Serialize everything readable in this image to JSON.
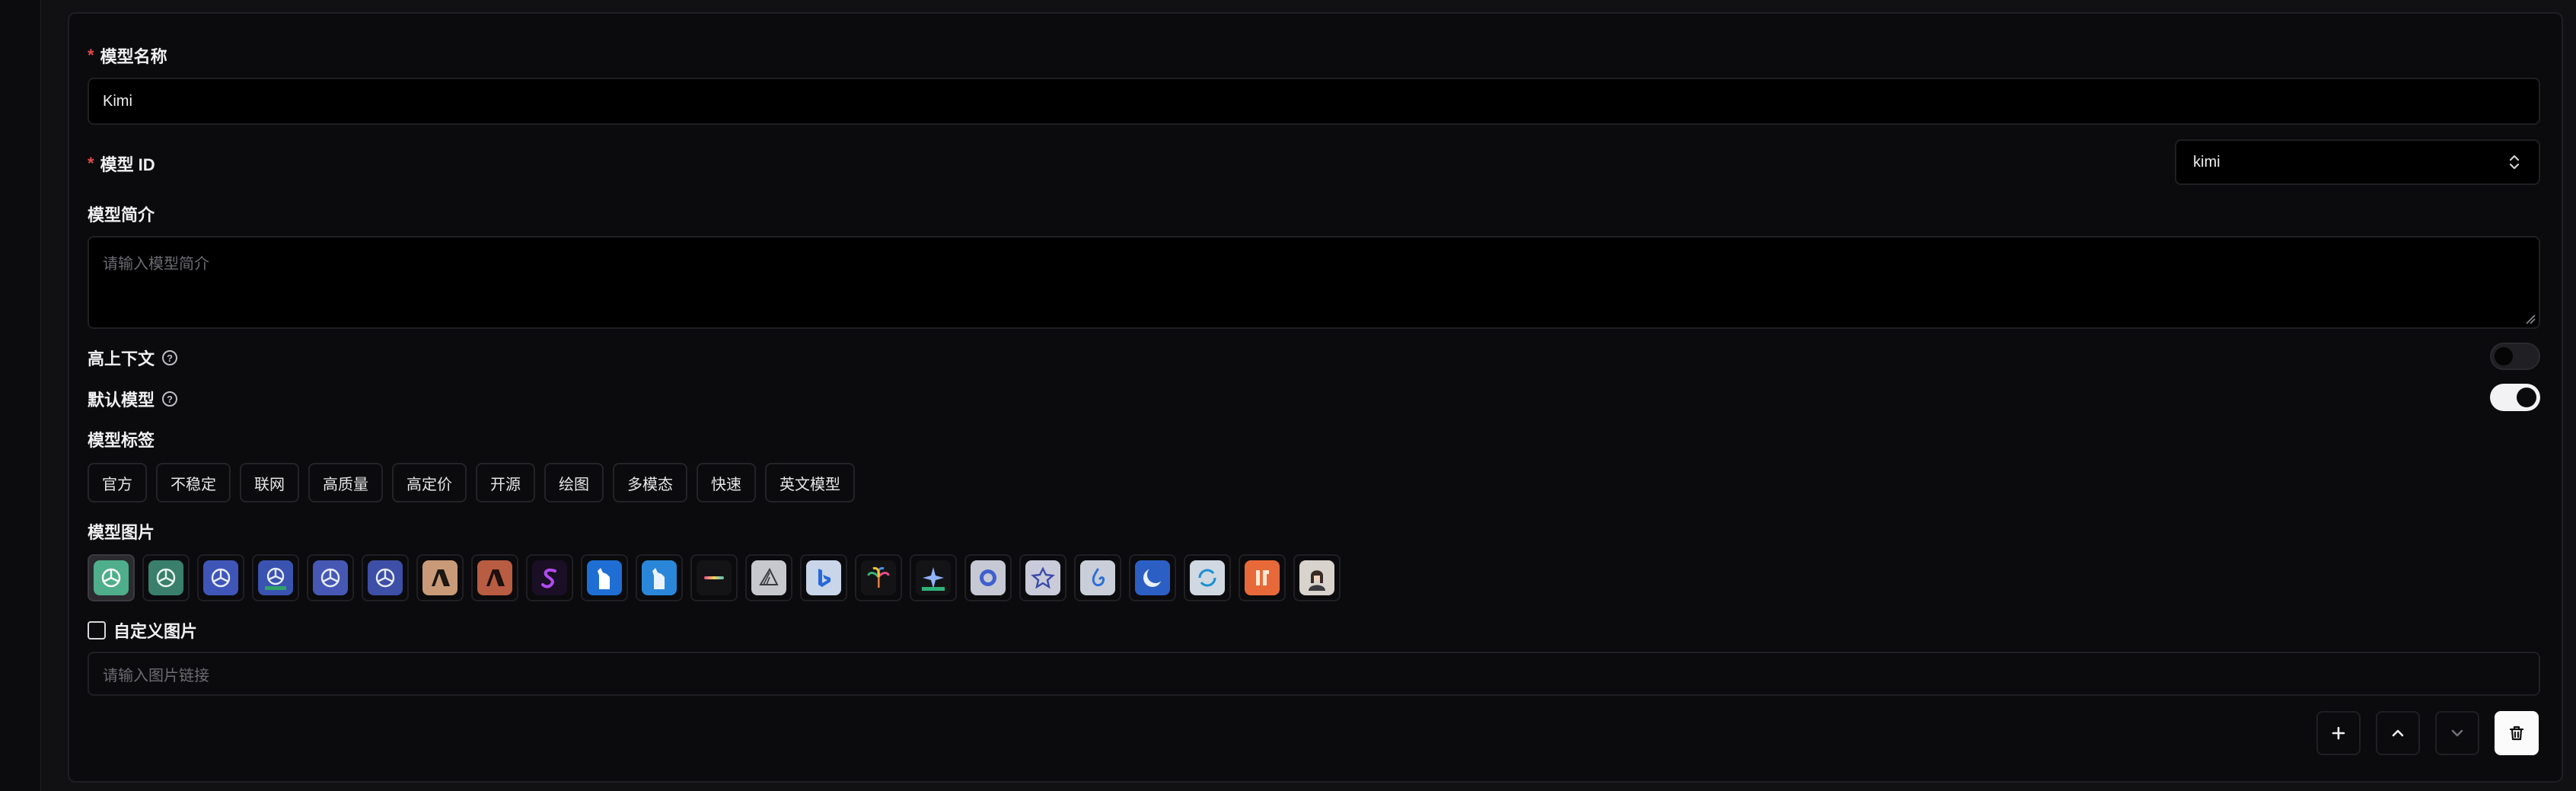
{
  "form": {
    "model_name": {
      "label": "模型名称",
      "required_mark": "*",
      "value": "Kimi"
    },
    "model_id": {
      "label": "模型 ID",
      "required_mark": "*",
      "selected": "kimi"
    },
    "model_desc": {
      "label": "模型简介",
      "placeholder": "请输入模型简介"
    },
    "long_context": {
      "label": "高上下文",
      "help_icon": "?",
      "enabled": false
    },
    "default_model": {
      "label": "默认模型",
      "help_icon": "?",
      "enabled": true
    },
    "model_tags": {
      "label": "模型标签",
      "items": [
        "官方",
        "不稳定",
        "联网",
        "高质量",
        "高定价",
        "开源",
        "绘图",
        "多模态",
        "快速",
        "英文模型"
      ]
    },
    "model_image": {
      "label": "模型图片",
      "selected_index": 0,
      "icons": [
        "openai-green-icon",
        "openai-teal-icon",
        "openai-blue-icon",
        "openai-blue-4-icon",
        "openai-blue-icon",
        "openai-blue-icon",
        "anthropic-tan-icon",
        "anthropic-rust-icon",
        "stable-s-purple-icon",
        "llama-blue-icon",
        "llama-light-blue-icon",
        "gradient-bar-icon",
        "sailboat-icon",
        "bing-icon",
        "palm-tree-icon",
        "sparkle-icon",
        "chatglm-icon",
        "spark-icon",
        "baichuan-icon",
        "crescent-icon",
        "cycle-icon",
        "ji-icon",
        "avatar-portrait-icon"
      ]
    },
    "custom_image": {
      "label": "自定义图片",
      "checked": false,
      "placeholder": "请输入图片链接"
    }
  },
  "actions": [
    "add-icon",
    "chevron-up-icon",
    "chevron-down-icon",
    "trash-icon"
  ]
}
